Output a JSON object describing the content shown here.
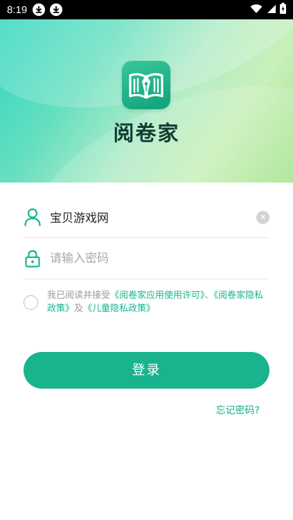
{
  "status_bar": {
    "time": "8:19",
    "icons": [
      "download-icon",
      "download-icon",
      "wifi-icon",
      "signal-icon",
      "battery-charging-icon"
    ]
  },
  "app": {
    "name": "阅卷家",
    "logo_icon": "book-pen-icon"
  },
  "login_form": {
    "username": {
      "icon": "user-icon",
      "value": "宝贝游戏网",
      "clear_icon": "clear-icon"
    },
    "password": {
      "icon": "lock-icon",
      "placeholder": "请输入密码"
    },
    "agreement": {
      "prefix": "我已阅读并接受",
      "link1": "《阅卷家应用使用许可》",
      "sep": "、",
      "link2": "《阅卷家隐私政策》",
      "conj": "及",
      "link3": "《儿童隐私政策》"
    },
    "login_label": "登录",
    "forgot_label": "忘记密码?"
  },
  "colors": {
    "accent": "#19b38d",
    "link": "#13b58d",
    "logo_bg": "#1db588",
    "title_text": "#123d33"
  }
}
